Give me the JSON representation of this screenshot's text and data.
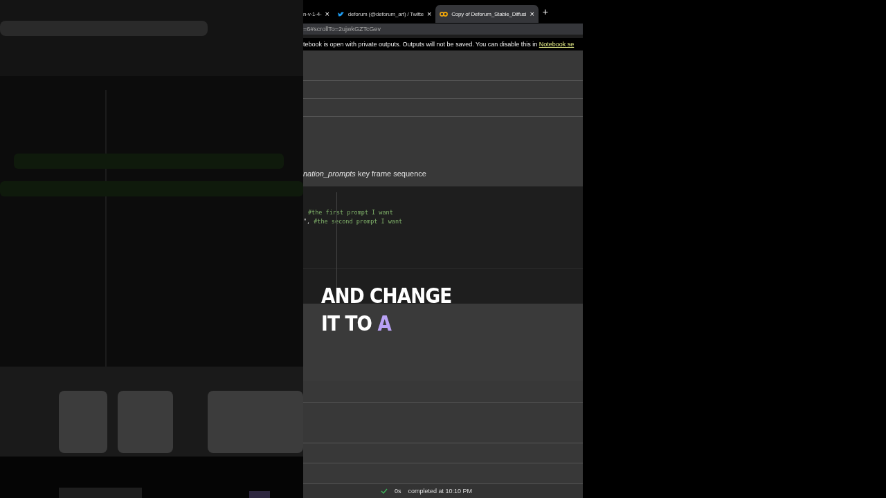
{
  "backdrop": {
    "kind": "picture"
  },
  "tabs": [
    {
      "label": "n-v-1-4-",
      "close": "×",
      "kind": "plain",
      "selected": false
    },
    {
      "label": "deforum (@deforum_art) / Twitte",
      "close": "×",
      "kind": "social",
      "selected": false
    },
    {
      "label": "Copy of Deforum_Stable_Diffusi",
      "close": "×",
      "kind": "notebook",
      "selected": true
    }
  ],
  "new_tab": "+",
  "address": "=6#scrollTo=2ujwkGZTcGev",
  "banner": {
    "text": "tebook is open with private outputs. Outputs will not be saved. You can disable this in ",
    "link": "Notebook se"
  },
  "section_heading": "*nation_prompts* key frame sequence",
  "code_lines": [
    {
      "comment": "#the first prompt I want"
    },
    {
      "prefix": "\",",
      "comment": "#the second prompt I want"
    }
  ],
  "caption": [
    [
      {
        "text": "AND CHANGE",
        "highlighted": false
      }
    ],
    [
      {
        "text": "IT TO",
        "highlighted": false
      },
      {
        "text": "A",
        "highlighted": true
      }
    ]
  ],
  "status": {
    "duration": "0s",
    "message": "completed at 10:10 PM"
  }
}
